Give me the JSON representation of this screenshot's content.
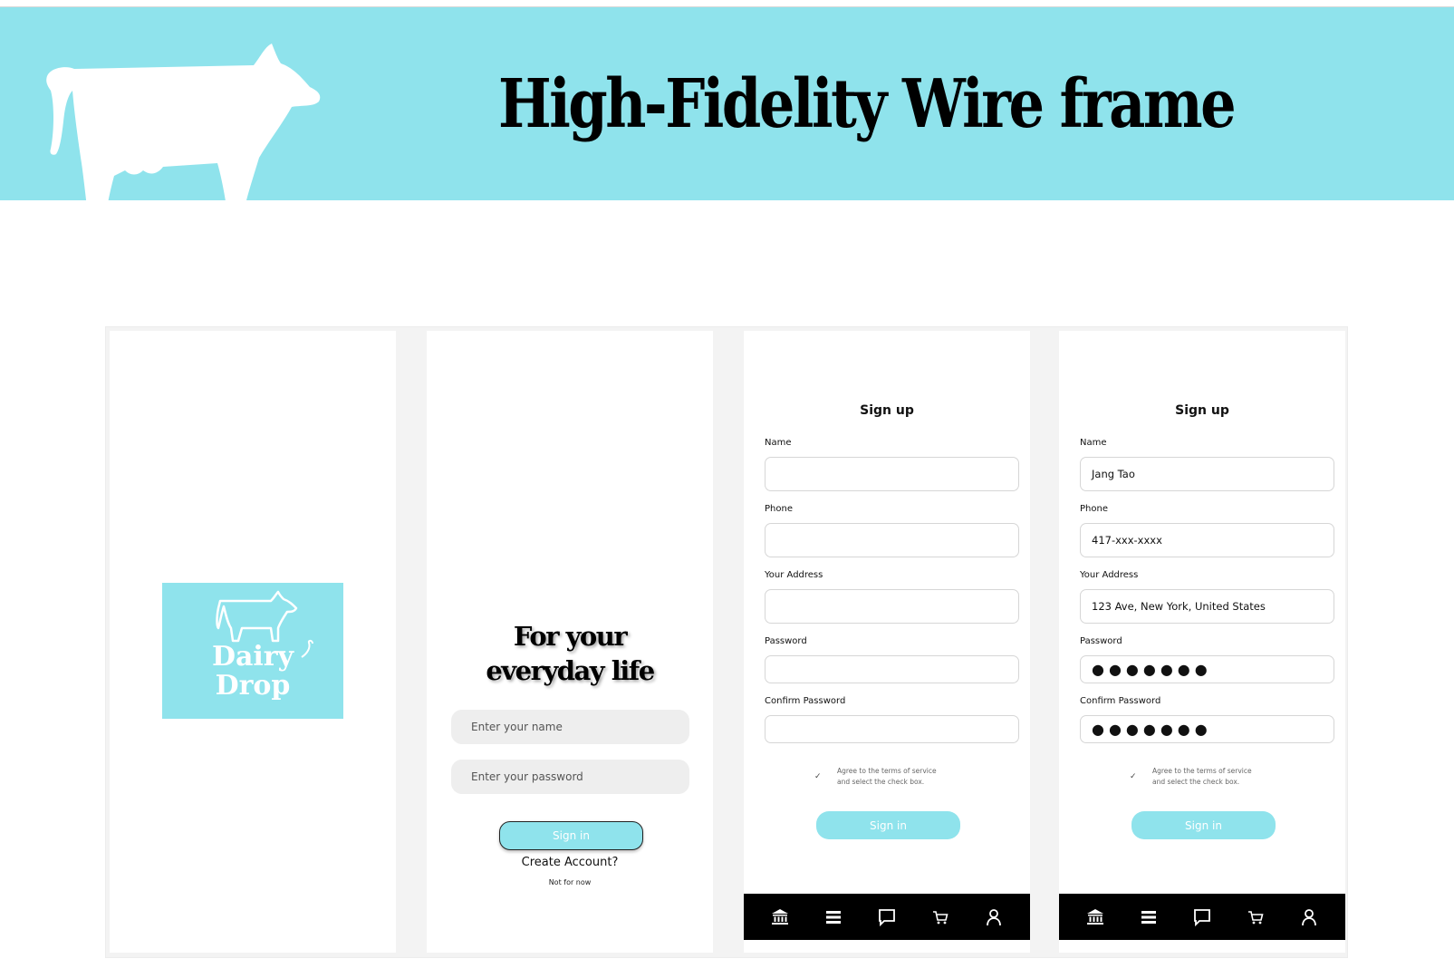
{
  "banner": {
    "title": "High-Fidelity Wire frame",
    "color": "#8fe3ec"
  },
  "splash": {
    "logo_line1": "Dairy",
    "logo_line2": "Drop"
  },
  "login": {
    "tagline_line1": "For your",
    "tagline_line2": "everyday life",
    "name_placeholder": "Enter your name",
    "password_placeholder": "Enter your password",
    "signin_label": "Sign in",
    "create_account": "Create Account?",
    "not_now": "Not for now"
  },
  "signup_empty": {
    "title": "Sign up",
    "name_label": "Name",
    "phone_label": "Phone",
    "address_label": "Your Address",
    "password_label": "Password",
    "confirm_label": "Confirm Password",
    "check_mark": "✓",
    "agree_line1": "Agree to the terms of service",
    "agree_line2": "and select the check box.",
    "signin_label": "Sign in"
  },
  "signup_filled": {
    "title": "Sign up",
    "name_label": "Name",
    "name_value": "Jang Tao",
    "phone_label": "Phone",
    "phone_value": "417-xxx-xxxx",
    "address_label": "Your Address",
    "address_value": "123 Ave, New York, United States",
    "password_label": "Password",
    "password_value": "●●●●●●●",
    "confirm_label": "Confirm Password",
    "confirm_value": "●●●●●●●",
    "check_mark": "✓",
    "agree_line1": "Agree to the terms of service",
    "agree_line2": "and select the check box.",
    "signin_label": "Sign in"
  },
  "navbar": {
    "icons": [
      "bank-icon",
      "menu-icon",
      "chat-icon",
      "cart-icon",
      "user-icon"
    ]
  }
}
